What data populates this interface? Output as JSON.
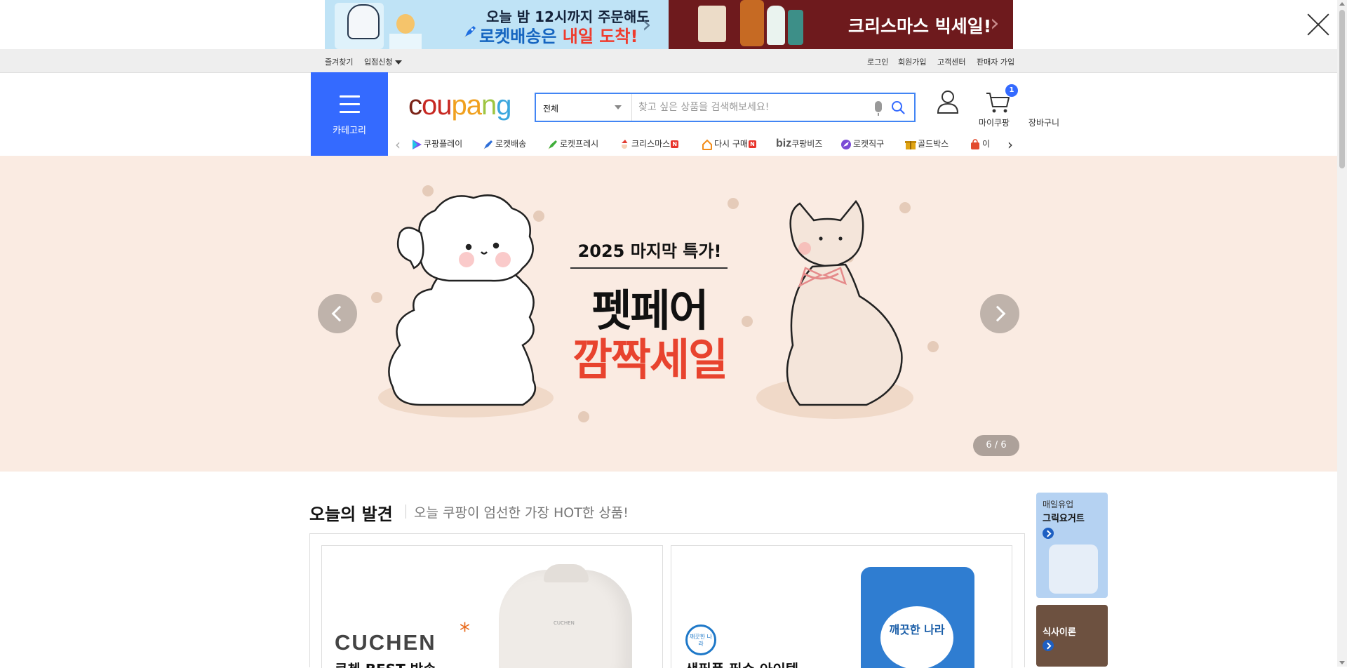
{
  "top_ads": [
    {
      "line1": "오늘 밤 12시까지 주문해도",
      "line2_prefix": "로켓배송은 ",
      "line2_highlight": "내일 도착!"
    },
    {
      "text": "크리스마스 빅세일!"
    }
  ],
  "util_bar": {
    "left": [
      "즐겨찾기",
      "입점신청"
    ],
    "right": [
      "로그인",
      "회원가입",
      "고객센터",
      "판매자 가입"
    ]
  },
  "header": {
    "category_label": "카테고리",
    "logo": [
      "c",
      "ou",
      "pa",
      "n",
      "g"
    ],
    "search_category": "전체",
    "search_placeholder": "찾고 싶은 상품을 검색해보세요!",
    "mypage_label": "마이쿠팡",
    "cart_label": "장바구니",
    "cart_count": "1"
  },
  "nav": {
    "items": [
      {
        "label": "쿠팡플레이",
        "icon": "play-icon",
        "color": "#7b55f2"
      },
      {
        "label": "로켓배송",
        "icon": "rocket-icon",
        "color": "#2f6fd8"
      },
      {
        "label": "로켓프레시",
        "icon": "rocket-fresh-icon",
        "color": "#3fae3a"
      },
      {
        "label": "크리스마스",
        "icon": "santa-icon",
        "color": "#e23b31",
        "badge": "N"
      },
      {
        "label": "다시 구매",
        "icon": "reorder-icon",
        "color": "#f28c1a",
        "badge": "N"
      },
      {
        "label": "쿠팡비즈",
        "icon": "biz-icon",
        "prefix": "biz"
      },
      {
        "label": "로켓직구",
        "icon": "global-icon",
        "color": "#7b4bd6"
      },
      {
        "label": "골드박스",
        "icon": "goldbox-icon",
        "color": "#e0a413"
      },
      {
        "label": "이",
        "icon": "new-bag-icon",
        "color": "#e24a2d"
      }
    ]
  },
  "hero": {
    "subtitle": "2025 마지막 특가!",
    "title_line1": "펫페어",
    "title_line2": "깜짝세일",
    "counter": "6 / 6",
    "bg_color": "#faebe2",
    "accent_color": "#e8432e"
  },
  "today": {
    "title": "오늘의 발견",
    "subtitle": "오늘 쿠팡이 엄선한 가장 HOT한 상품!",
    "cards": [
      {
        "brand": "CUCHEN",
        "brand_mark": "*",
        "caption": "쿠첸 BEST 방송",
        "product_label": "CUCHEN"
      },
      {
        "brand_badge": "깨끗한 나라",
        "caption": "생필품 필수 아이템",
        "product_label": "깨끗한 나라"
      }
    ]
  },
  "side_ads": [
    {
      "line1": "매일유업",
      "line2": "그릭요거트"
    },
    {
      "line2": "식사이론"
    }
  ]
}
